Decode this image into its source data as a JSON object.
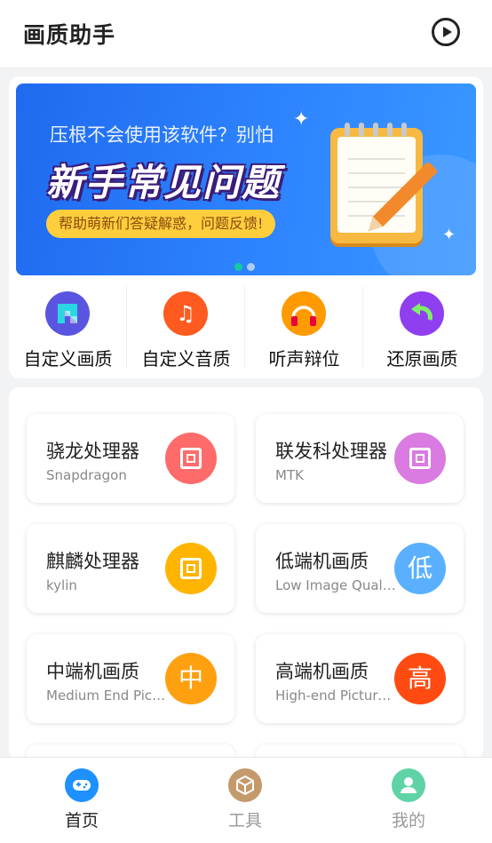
{
  "app_bar": {
    "title": "画质助手",
    "play_icon": "play-circle-icon"
  },
  "banner": {
    "subtitle": "压根不会使用该软件？别怕",
    "headline": "新手常见问题",
    "pill_text": "帮助萌新们答疑解惑，问题反馈!",
    "page_count": 2,
    "active_page": 1
  },
  "quick_actions": [
    {
      "label": "自定义画质",
      "icon": "custom-quality-icon",
      "color": "#5a55e0"
    },
    {
      "label": "自定义音质",
      "icon": "music-note-icon",
      "color": "#ff5a1f"
    },
    {
      "label": "听声辩位",
      "icon": "headphones-icon",
      "color": "#ff9a00"
    },
    {
      "label": "还原画质",
      "icon": "restore-arrow-icon",
      "color": "#8f3ff0"
    }
  ],
  "tiles": [
    {
      "title": "骁龙处理器",
      "subtitle": "Snapdragon",
      "icon": "chip-icon",
      "color": "#ff6b6b"
    },
    {
      "title": "联发科处理器",
      "subtitle": "MTK",
      "icon": "chip-icon",
      "color": "#d97be0"
    },
    {
      "title": "麒麟处理器",
      "subtitle": "kylin",
      "icon": "chip-icon",
      "color": "#ffb400"
    },
    {
      "title": "低端机画质",
      "subtitle": "Low Image Quality",
      "icon_char": "低",
      "color": "#5ab0ff"
    },
    {
      "title": "中端机画质",
      "subtitle": "Medium End Picture Quality",
      "icon_char": "中",
      "color": "#ffa010"
    },
    {
      "title": "高端机画质",
      "subtitle": "High-end Picture Quality",
      "icon_char": "高",
      "color": "#ff4b12"
    }
  ],
  "bottom_nav": [
    {
      "label": "首页",
      "icon": "gamepad-icon",
      "color": "#1e90ff",
      "active": true
    },
    {
      "label": "工具",
      "icon": "box-icon",
      "color": "#c49a6c",
      "active": false
    },
    {
      "label": "我的",
      "icon": "user-icon",
      "color": "#5fd3a6",
      "active": false
    }
  ]
}
